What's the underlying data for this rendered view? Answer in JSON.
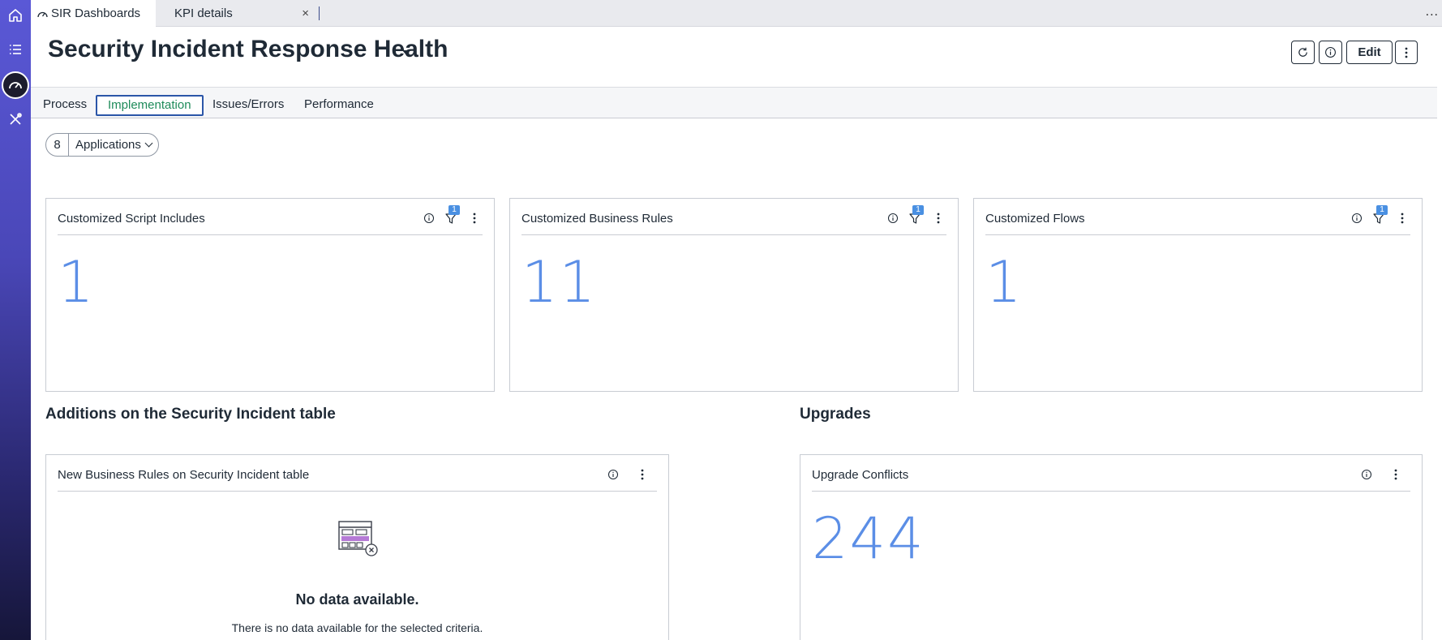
{
  "browser_tabs": [
    {
      "label": "SIR Dashboards",
      "active": true
    },
    {
      "label": "KPI details",
      "active": false,
      "close": "×"
    }
  ],
  "more_menu": "...",
  "header": {
    "title": "Security Incident Response Health",
    "edit_label": "Edit"
  },
  "page_tabs": [
    {
      "label": "Process"
    },
    {
      "label": "Implementation",
      "selected": true
    },
    {
      "label": "Issues/Errors"
    },
    {
      "label": "Performance"
    }
  ],
  "filter_pill": {
    "count": "8",
    "label": "Applications"
  },
  "kpi_cards": [
    {
      "title": "Customized Script Includes",
      "value": "1",
      "filter_count": "1"
    },
    {
      "title": "Customized Business Rules",
      "value": "11",
      "filter_count": "1"
    },
    {
      "title": "Customized Flows",
      "value": "1",
      "filter_count": "1"
    }
  ],
  "sections": {
    "additions": {
      "heading": "Additions on the Security Incident table",
      "card": {
        "title": "New Business Rules on Security Incident table",
        "empty_title": "No data available.",
        "empty_subtitle": "There is no data available for the selected criteria."
      }
    },
    "upgrades": {
      "heading": "Upgrades",
      "card": {
        "title": "Upgrade Conflicts",
        "value": "244"
      }
    }
  },
  "icons": {
    "rail": [
      "home-icon",
      "list-icon",
      "dashboard-icon",
      "tools-icon"
    ],
    "header": [
      "refresh-icon",
      "info-icon",
      "kebab-icon"
    ]
  },
  "colors": {
    "rail_top": "#5a58d6",
    "rail_bottom": "#16163a",
    "kpi_number": "#5b8ee6",
    "selected_tab_text": "#1e8b5a",
    "selected_tab_border": "#2b56a8",
    "filter_badge": "#4a90e2"
  }
}
